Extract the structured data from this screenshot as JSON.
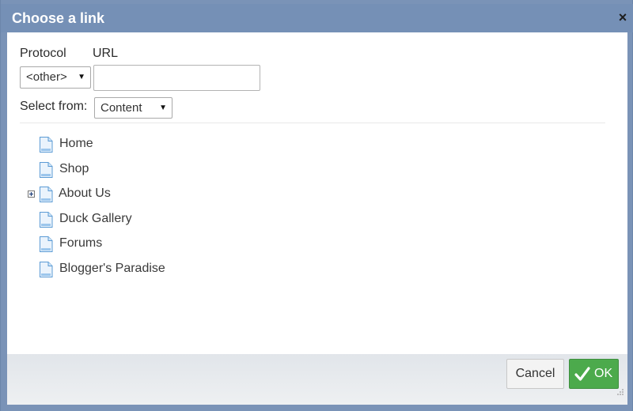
{
  "dialog": {
    "title": "Choose a link",
    "close_symbol": "×"
  },
  "form": {
    "protocol_label": "Protocol",
    "url_label": "URL",
    "protocol_selected": "<other>",
    "url_value": "",
    "select_from_label": "Select from:",
    "select_from_selected": "Content"
  },
  "tree": {
    "items": [
      {
        "label": "Home",
        "icon": "page-icon",
        "expandable": false
      },
      {
        "label": "Shop",
        "icon": "page-icon",
        "expandable": false
      },
      {
        "label": "About Us",
        "icon": "page-icon",
        "expandable": true
      },
      {
        "label": "Duck Gallery",
        "icon": "page-icon",
        "expandable": false
      },
      {
        "label": "Forums",
        "icon": "page-icon",
        "expandable": false
      },
      {
        "label": "Blogger's Paradise",
        "icon": "page-icon",
        "expandable": false
      }
    ]
  },
  "footer": {
    "cancel_label": "Cancel",
    "ok_label": "OK"
  },
  "colors": {
    "titlebar": "#7590b6",
    "ok_button": "#4caa4c",
    "page_icon": "#5b9bd5"
  }
}
